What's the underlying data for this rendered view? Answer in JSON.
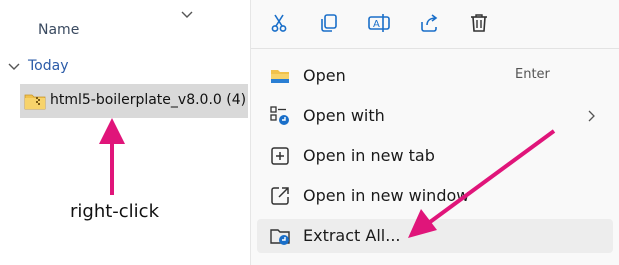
{
  "explorer": {
    "column_header": "Name",
    "group_label": "Today",
    "file_name": "html5-boilerplate_v8.0.0 (4)",
    "icons": {
      "sort": "chevron-down-icon",
      "group": "chevron-down-icon",
      "file": "zip-folder-icon"
    }
  },
  "annotation": {
    "label": "right-click",
    "arrow_color": "#e0157a"
  },
  "context_menu": {
    "toolbar": [
      {
        "name": "cut",
        "icon": "scissors-icon"
      },
      {
        "name": "copy",
        "icon": "copy-icon"
      },
      {
        "name": "rename",
        "icon": "rename-icon"
      },
      {
        "name": "share",
        "icon": "share-icon"
      },
      {
        "name": "delete",
        "icon": "trash-icon"
      }
    ],
    "items": [
      {
        "label": "Open",
        "shortcut": "Enter",
        "icon": "folder-icon"
      },
      {
        "label": "Open with",
        "has_submenu": true,
        "icon": "open-with-icon"
      },
      {
        "label": "Open in new tab",
        "icon": "new-tab-icon"
      },
      {
        "label": "Open in new window",
        "icon": "new-window-icon"
      },
      {
        "label": "Extract All...",
        "icon": "extract-icon",
        "highlighted": true
      }
    ],
    "accent": "#1a6fc9"
  }
}
